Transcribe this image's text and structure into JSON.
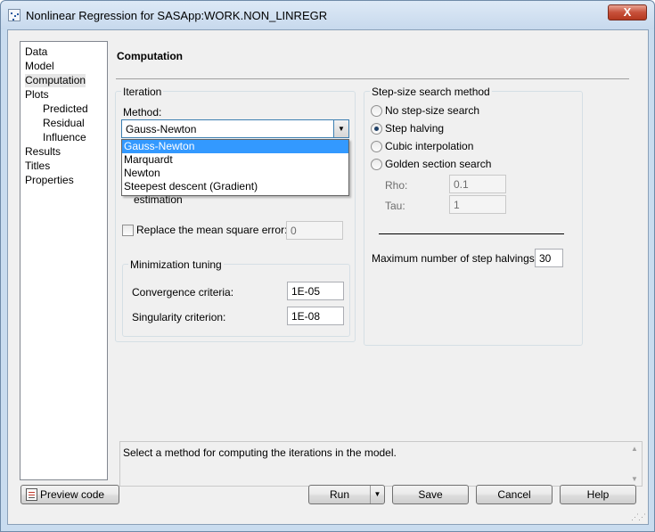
{
  "window": {
    "title": "Nonlinear Regression for SASApp:WORK.NON_LINREGR",
    "close_label": "X"
  },
  "nav": {
    "items": [
      {
        "label": "Data"
      },
      {
        "label": "Model"
      },
      {
        "label": "Computation"
      },
      {
        "label": "Plots"
      },
      {
        "label": "Predicted"
      },
      {
        "label": "Residual"
      },
      {
        "label": "Influence"
      },
      {
        "label": "Results"
      },
      {
        "label": "Titles"
      },
      {
        "label": "Properties"
      }
    ]
  },
  "page": {
    "title": "Computation",
    "iteration": {
      "group_label": "Iteration",
      "method_label": "Method:",
      "method_value": "Gauss-Newton",
      "method_options": [
        "Gauss-Newton",
        "Marquardt",
        "Newton",
        "Steepest descent (Gradient)"
      ],
      "hidden_option_label": "estimation",
      "replace_mse_label": "Replace the mean square error:",
      "replace_mse_value": "0",
      "tuning": {
        "group_label": "Minimization tuning",
        "convergence_label": "Convergence criteria:",
        "convergence_value": "1E-05",
        "singularity_label": "Singularity criterion:",
        "singularity_value": "1E-08"
      }
    },
    "stepsize": {
      "group_label": "Step-size search method",
      "options": [
        {
          "label": "No step-size search",
          "selected": false
        },
        {
          "label": "Step halving",
          "selected": true
        },
        {
          "label": "Cubic interpolation",
          "selected": false
        },
        {
          "label": "Golden section search",
          "selected": false
        }
      ],
      "rho_label": "Rho:",
      "rho_value": "0.1",
      "tau_label": "Tau:",
      "tau_value": "1",
      "max_halvings_label": "Maximum number of step halvings:",
      "max_halvings_value": "30"
    },
    "help_text": "Select a method for computing the iterations in the model."
  },
  "buttons": {
    "preview": "Preview code",
    "run": "Run",
    "save": "Save",
    "cancel": "Cancel",
    "help": "Help"
  }
}
